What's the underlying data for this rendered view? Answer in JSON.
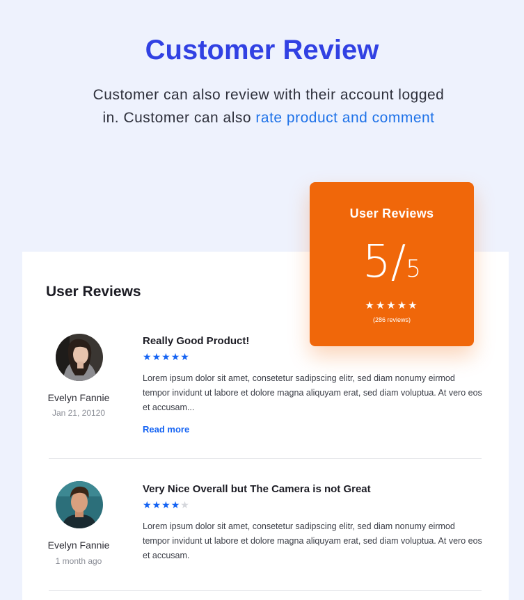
{
  "hero": {
    "title": "Customer Review",
    "description_prefix": "Customer can also review with their account logged in. Customer can also ",
    "description_highlight": "rate product and comment"
  },
  "panel": {
    "title": "User Reviews"
  },
  "reviews": [
    {
      "author": "Evelyn Fannie",
      "date": "Jan 21, 20120",
      "title": "Really Good Product!",
      "rating": 5,
      "max_rating": 5,
      "body": "Lorem ipsum dolor sit amet, consetetur sadipscing elitr, sed diam nonumy eirmod tempor invidunt ut labore et dolore magna aliquyam erat, sed diam voluptua. At vero eos et accusam...",
      "read_more": "Read more"
    },
    {
      "author": "Evelyn Fannie",
      "date": "1 month ago",
      "title": "Very Nice Overall but The Camera is not Great",
      "rating": 4,
      "max_rating": 5,
      "body": "Lorem ipsum dolor sit amet, consetetur sadipscing elitr, sed diam nonumy eirmod tempor invidunt ut labore et dolore magna aliquyam erat, sed diam voluptua. At vero eos et accusam."
    }
  ],
  "summary": {
    "title": "User Reviews",
    "score": "5",
    "slash": "/",
    "out_of": "5",
    "rating": 5,
    "count_label": "(286 reviews)"
  },
  "colors": {
    "accent_blue": "#3141e3",
    "link_blue": "#1463f3",
    "card_orange": "#f0670a",
    "background": "#eef2fd"
  },
  "icons": {
    "star": "star-icon",
    "avatar": "avatar"
  }
}
